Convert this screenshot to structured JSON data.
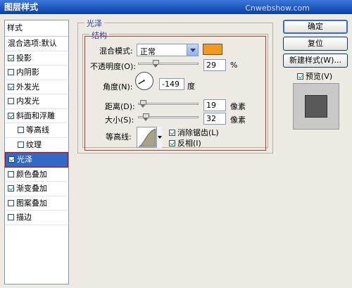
{
  "window": {
    "title": "图层样式",
    "watermark": "Cnwebshow.com"
  },
  "style_list": {
    "header": "样式",
    "items": [
      {
        "label": "混合选项:默认",
        "check": null,
        "sub": false
      },
      {
        "label": "投影",
        "check": true,
        "sub": false
      },
      {
        "label": "内阴影",
        "check": false,
        "sub": false
      },
      {
        "label": "外发光",
        "check": true,
        "sub": false
      },
      {
        "label": "内发光",
        "check": false,
        "sub": false
      },
      {
        "label": "斜面和浮雕",
        "check": true,
        "sub": false
      },
      {
        "label": "等高线",
        "check": false,
        "sub": true
      },
      {
        "label": "纹理",
        "check": false,
        "sub": true
      },
      {
        "label": "光泽",
        "check": true,
        "sub": false,
        "selected": true
      },
      {
        "label": "颜色叠加",
        "check": false,
        "sub": false
      },
      {
        "label": "渐变叠加",
        "check": true,
        "sub": false
      },
      {
        "label": "图案叠加",
        "check": false,
        "sub": false
      },
      {
        "label": "描边",
        "check": false,
        "sub": false
      }
    ]
  },
  "panel": {
    "group_title": "光泽",
    "structure_title": "结构",
    "blend_mode_label": "混合模式:",
    "blend_mode_value": "正常",
    "blend_color": "#f39a1c",
    "opacity_label": "不透明度(O):",
    "opacity_value": "29",
    "opacity_unit": "%",
    "opacity_fraction": 0.29,
    "angle_label": "角度(N):",
    "angle_value": "-149",
    "angle_unit": "度",
    "angle_degrees": -149,
    "distance_label": "距离(D):",
    "distance_value": "19",
    "distance_unit": "像素",
    "distance_fraction": 0.08,
    "size_label": "大小(S):",
    "size_value": "32",
    "size_unit": "像素",
    "size_fraction": 0.13,
    "contour_label": "等高线:",
    "anti_alias_label": "消除锯齿(L)",
    "anti_alias_checked": true,
    "invert_label": "反相(I)",
    "invert_checked": true
  },
  "buttons": {
    "ok": "确定",
    "reset": "复位",
    "new_style": "新建样式(W)...",
    "preview_label": "预览(V)",
    "preview_checked": true
  }
}
